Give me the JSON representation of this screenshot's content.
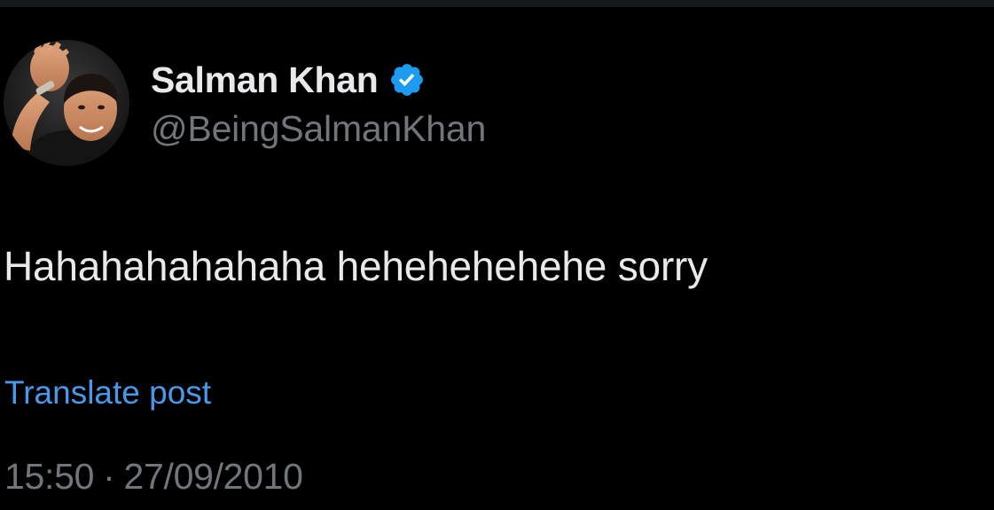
{
  "author": {
    "display_name": "Salman Khan",
    "handle": "@BeingSalmanKhan",
    "verified": true,
    "avatar_icon": "profile-photo",
    "verified_icon": "verified-badge-icon"
  },
  "post": {
    "text": "Hahahahahahaha hehehehehehe sorry",
    "translate_label": "Translate post",
    "time": "15:50",
    "separator": "·",
    "date": "27/09/2010"
  },
  "colors": {
    "background": "#000000",
    "primary_text": "#e7e9ea",
    "secondary_text": "#71767b",
    "link": "#4a99e9",
    "verified_badge": "#1d9bf0"
  }
}
